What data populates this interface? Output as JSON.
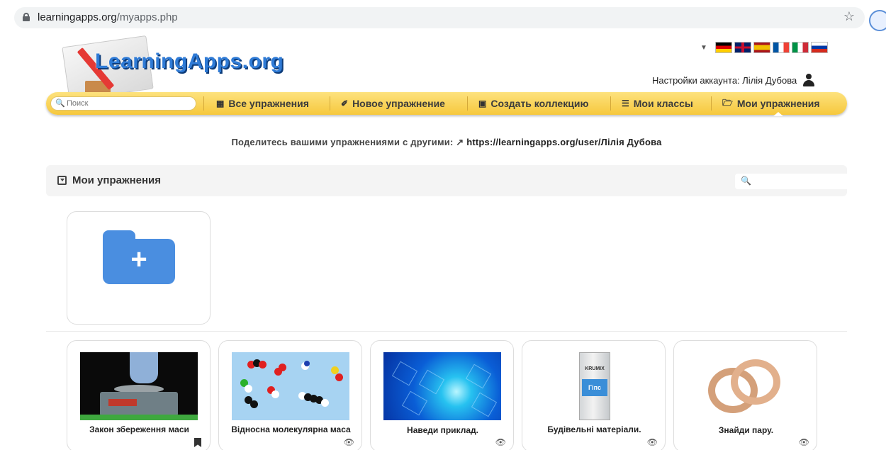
{
  "browser": {
    "url_host": "learningapps.org",
    "url_path": "/myapps.php"
  },
  "header": {
    "logo_text": "LearningApps.org",
    "account_label": "Настройки аккаунта: Лілія Дубова",
    "languages": [
      "de",
      "en",
      "es",
      "fr",
      "it",
      "ru"
    ]
  },
  "nav": {
    "search_placeholder": "Поиск",
    "items": [
      {
        "label": "Все упражнения",
        "icon": "grid-icon"
      },
      {
        "label": "Новое упражнение",
        "icon": "pencil-icon"
      },
      {
        "label": "Создать коллекцию",
        "icon": "collection-icon"
      },
      {
        "label": "Мои классы",
        "icon": "list-icon"
      },
      {
        "label": "Мои упражнения",
        "icon": "folder-open-icon",
        "active": true
      }
    ]
  },
  "share": {
    "text": "Поделитесь вашими упражнениями с другими:",
    "link": "https://learningapps.org/user/Лілія Дубова"
  },
  "panel": {
    "title": "Мои упражнения",
    "search_placeholder": ""
  },
  "apps": [
    {
      "title": "Закон збереження маси",
      "status_icon": "bookmark-icon",
      "thumb": "scale"
    },
    {
      "title": "Відносна молекулярна маса",
      "status_icon": "eye-slash-icon",
      "thumb": "molecules"
    },
    {
      "title": "Наведи приклад.",
      "status_icon": "eye-slash-icon",
      "thumb": "hexagons"
    },
    {
      "title": "Будівельні матеріали.",
      "status_icon": "eye-slash-icon",
      "thumb": "gypsum-bag"
    },
    {
      "title": "Знайди пару.",
      "status_icon": "eye-slash-icon",
      "thumb": "rings"
    }
  ],
  "thumb_text": {
    "bag_brand": "KRUMIX",
    "bag_label": "Гіпс"
  },
  "colors": {
    "nav_bg": "#f6c83c",
    "logo_blue": "#2f7bd6",
    "folder_blue": "#4a8ee0"
  }
}
